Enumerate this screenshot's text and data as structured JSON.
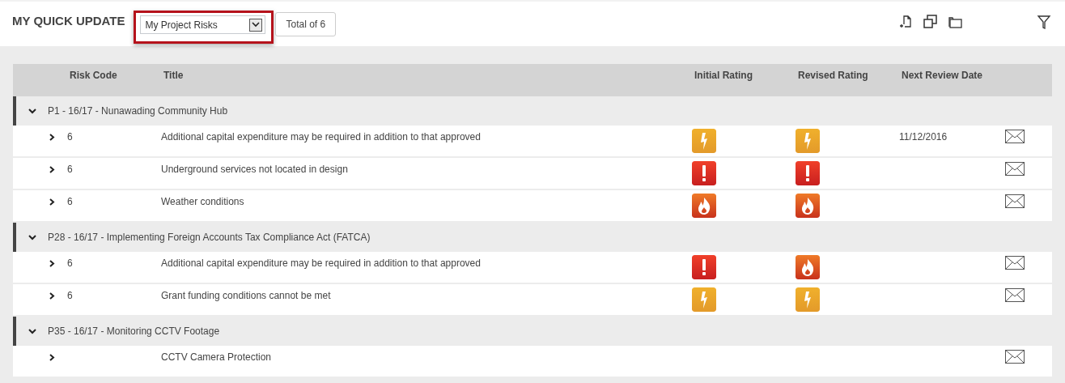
{
  "header": {
    "title": "MY QUICK UPDATE",
    "view_select": {
      "value": "My Project Risks"
    },
    "total": "Total of 6"
  },
  "table": {
    "columns": [
      "Risk Code",
      "Title",
      "Initial Rating",
      "Revised Rating",
      "Next Review Date"
    ],
    "groups": [
      {
        "title": "P1 - 16/17 - Nunawading Community Hub",
        "expanded": true,
        "rows": [
          {
            "code": "6",
            "title": "Additional capital expenditure may be required in addition to that approved",
            "initial": {
              "kind": "lightning"
            },
            "revised": {
              "kind": "lightning"
            },
            "next_review": "11/12/2016"
          },
          {
            "code": "6",
            "title": "Underground services not located in design",
            "initial": {
              "kind": "exclamation"
            },
            "revised": {
              "kind": "exclamation"
            }
          },
          {
            "code": "6",
            "title": "Weather conditions",
            "initial": {
              "kind": "fire"
            },
            "revised": {
              "kind": "fire"
            }
          }
        ]
      },
      {
        "title": "P28 - 16/17 - Implementing Foreign Accounts Tax Compliance Act (FATCA)",
        "expanded": true,
        "rows": [
          {
            "code": "6",
            "title": "Additional capital expenditure may be required in addition to that approved",
            "initial": {
              "kind": "exclamation"
            },
            "revised": {
              "kind": "fire"
            }
          },
          {
            "code": "6",
            "title": "Grant funding conditions cannot be met",
            "initial": {
              "kind": "lightning"
            },
            "revised": {
              "kind": "lightning"
            }
          }
        ]
      },
      {
        "title": "P35 - 16/17 - Monitoring CCTV Footage",
        "expanded": true,
        "rows": [
          {
            "title": "CCTV Camera Protection"
          }
        ]
      }
    ]
  }
}
